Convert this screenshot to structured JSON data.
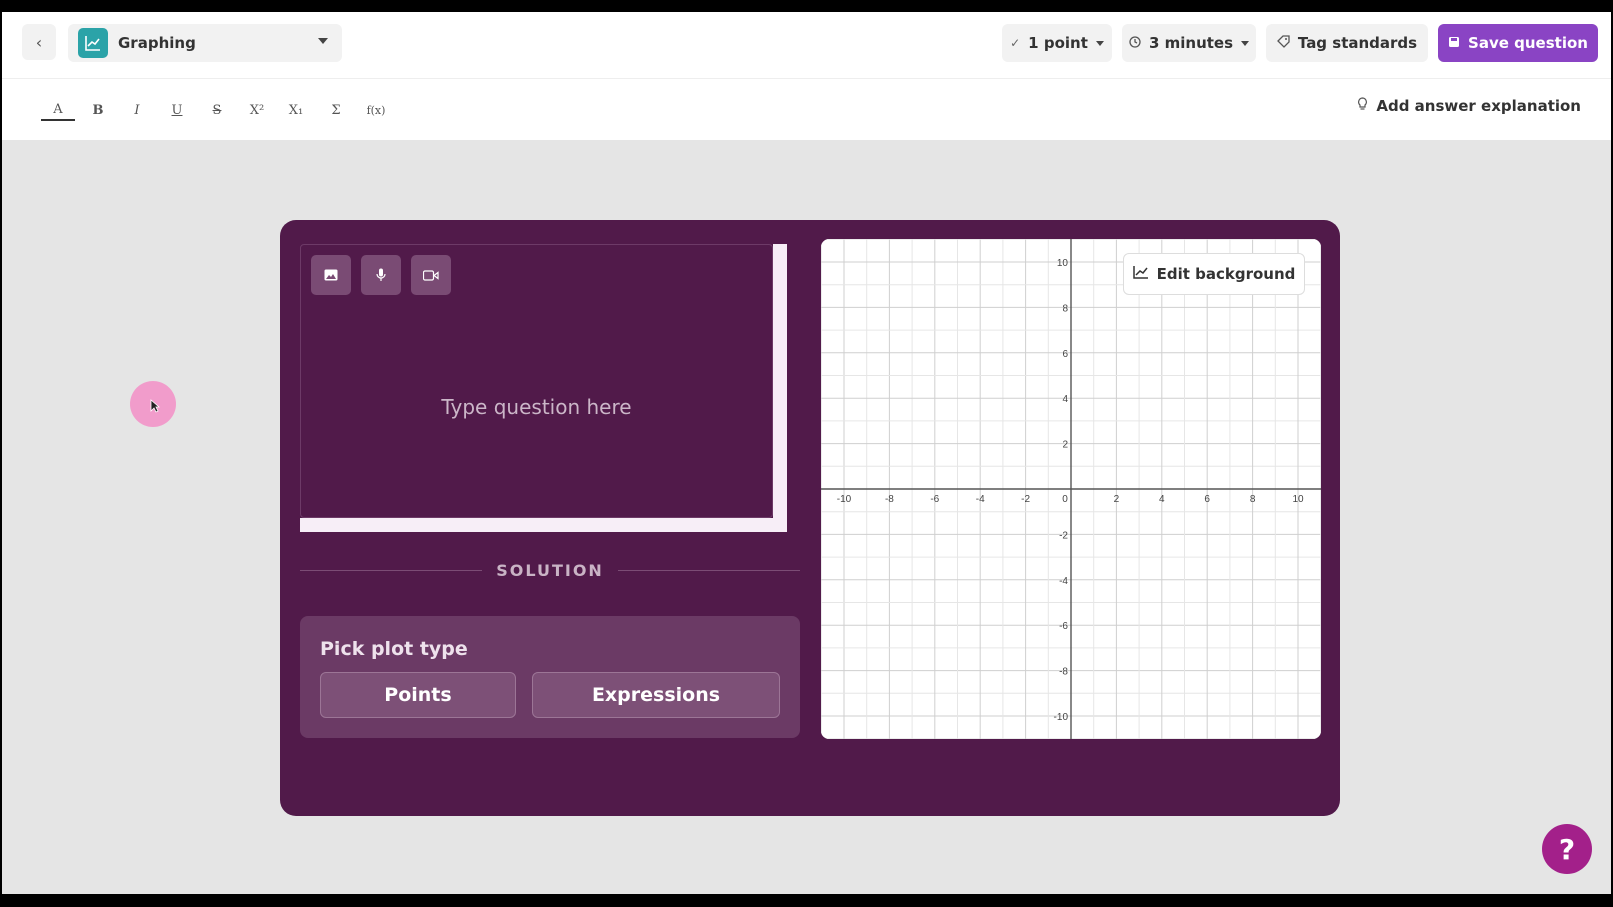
{
  "header": {
    "back_icon": "chevron-left-icon",
    "question_type": "Graphing",
    "points": "1 point",
    "time": "3 minutes",
    "tag_standards": "Tag standards",
    "save": "Save question"
  },
  "toolbar": {
    "format_buttons": [
      {
        "name": "text-color",
        "label": "A"
      },
      {
        "name": "bold",
        "label": "B"
      },
      {
        "name": "italic",
        "label": "I"
      },
      {
        "name": "underline",
        "label": "U"
      },
      {
        "name": "strikethrough",
        "label": "S"
      },
      {
        "name": "superscript",
        "label": "X²"
      },
      {
        "name": "subscript",
        "label": "X₁"
      },
      {
        "name": "summation",
        "label": "Σ"
      },
      {
        "name": "function",
        "label": "f(x)"
      }
    ],
    "add_explanation": "Add answer explanation"
  },
  "question": {
    "placeholder": "Type question here",
    "media_buttons": [
      "image-icon",
      "mic-icon",
      "video-icon"
    ]
  },
  "solution": {
    "label": "SOLUTION",
    "pick_title": "Pick plot type",
    "options": [
      "Points",
      "Expressions"
    ]
  },
  "graph": {
    "edit_background": "Edit background",
    "x_range": [
      -10,
      10
    ],
    "y_range": [
      -10,
      10
    ],
    "tick_step": 2,
    "x_ticks": [
      "-10",
      "-8",
      "-6",
      "-4",
      "-2",
      "0",
      "2",
      "4",
      "6",
      "8",
      "10"
    ],
    "y_ticks": [
      "10",
      "8",
      "6",
      "4",
      "2",
      "-2",
      "-4",
      "-6",
      "-8",
      "-10"
    ]
  },
  "help": "?",
  "colors": {
    "card": "#511a4a",
    "accent": "#8a44c4",
    "help": "#a3208a"
  }
}
